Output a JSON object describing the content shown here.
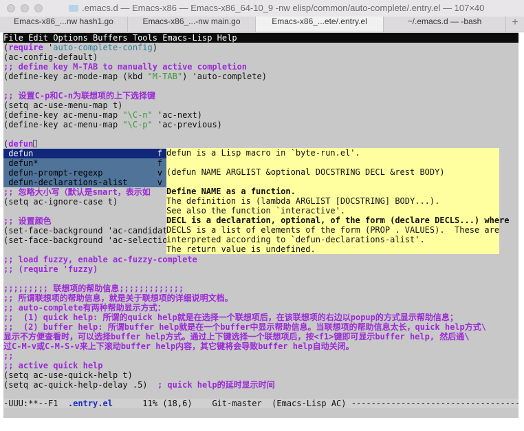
{
  "window": {
    "title": ".emacs.d — Emacs-x86 — Emacs-x86_64-10_9 -nw elisp/common/auto-complete/.entry.el — 107×40"
  },
  "tabs": [
    {
      "label": "Emacs-x86_...nw hash1.go"
    },
    {
      "label": "Emacs-x86_...-nw main.go"
    },
    {
      "label": "Emacs-x86_...ete/.entry.el"
    },
    {
      "label": "~/.emacs.d — -bash"
    }
  ],
  "tab_plus": "+",
  "menubar": "File Edit Options Buffers Tools Emacs-Lisp Help",
  "code": {
    "l1a": "(",
    "l1b": "require",
    "l1c": " '",
    "l1d": "auto-complete-config",
    "l1e": ")",
    "l2": "(ac-config-default)",
    "l3": ";; define key M-TAB to manually active completion",
    "l4a": "(define-key ac-mode-map (kbd ",
    "l4b": "\"M-TAB\"",
    "l4c": ") 'auto-complete)",
    "l5": ";; 设置C-p和C-n为联想项的上下选择键",
    "l6": "(setq ac-use-menu-map t)",
    "l7a": "(define-key ac-menu-map ",
    "l7b": "\"\\C-n\"",
    "l7c": " 'ac-next)",
    "l8a": "(define-key ac-menu-map ",
    "l8b": "\"\\C-p\"",
    "l8c": " 'ac-previous)",
    "l9a": "(",
    "l9b": "defun",
    "l10": ";; 忽略大小写（默认是smart，表示如",
    "l11": "(setq ac-ignore-case t)",
    "l12": ";; 设置颜色",
    "l13": "(set-face-background 'ac-candidate",
    "l14": "(set-face-background 'ac-selection",
    "l15": ";; load fuzzy, enable ac-fuzzy-complete",
    "l16": ";; (require 'fuzzy)",
    "l17": ";;;;;;;;; 联想项的帮助信息;;;;;;;;;;;;;",
    "l18": ";; 所谓联想项的帮助信息，就是关于联想项的详细说明文档。",
    "l19": ";; auto-complete有两种帮助显示方式：",
    "l20": ";;  (1) quick help: 所谓的quick help就是在选择一个联想项后，在该联想项的右边以popup的方式显示帮助信息；",
    "l21": ";;  (2) buffer help: 所谓buffer help就是在一个buffer中显示帮助信息。当联想项的帮助信息太长，quick help方式\\",
    "l22": "显示不方便查看时，可以选择buffer help方式。通过上下键选择一个联想项后，按<f1>键即可显示buffer help, 然后通\\",
    "l23": "过C-M-v或C-M-S-v来上下滚动buffer help内容，其它键将会导致buffer help自动关闭。",
    "l24": ";;",
    "l25": ";; active quick help",
    "l26": "(setq ac-use-quick-help t)",
    "l27a": "(setq ac-quick-help-delay .5)",
    "l27b": "  ; quick help的延时显示时间"
  },
  "popup": [
    {
      "label": " defun",
      "tag": "f",
      "selected": true
    },
    {
      "label": " defun*",
      "tag": "f",
      "selected": false
    },
    {
      "label": " defun-prompt-regexp",
      "tag": "v",
      "selected": false
    },
    {
      "label": " defun-declarations-alist",
      "tag": "v",
      "selected": false
    }
  ],
  "help": {
    "h1": "defun is a Lisp macro in `byte-run.el'.",
    "h2": "",
    "h3": "(defun NAME ARGLIST &optional DOCSTRING DECL &rest BODY)",
    "h4": "",
    "h5": "Define NAME as a function.",
    "h6": "The definition is (lambda ARGLIST [DOCSTRING] BODY...).",
    "h7": "See also the function `interactive'.",
    "h8": "DECL is a declaration, optional, of the form (declare DECLS...) where",
    "h9": "DECLS is a list of elements of the form (PROP . VALUES).  These are",
    "h10": "interpreted according to `defun-declarations-alist'.",
    "h11": "The return value is undefined."
  },
  "modeline": {
    "left": "-UUU:**--F1  ",
    "buffer": ".entry.el",
    "right": "      11% (18,6)    Git-master  (Emacs-Lisp AC) -----------------------------------------------"
  },
  "colors": {
    "menubar_bg": "#0b0b0b",
    "terminal_bg": "#c8c8c8",
    "keyword": "#a020f0",
    "comment": "#9b2bd6",
    "string": "#3a9a3a",
    "popup_bg": "#4f7399",
    "popup_selected_bg": "#10277b",
    "help_bg": "#ffffa0"
  }
}
